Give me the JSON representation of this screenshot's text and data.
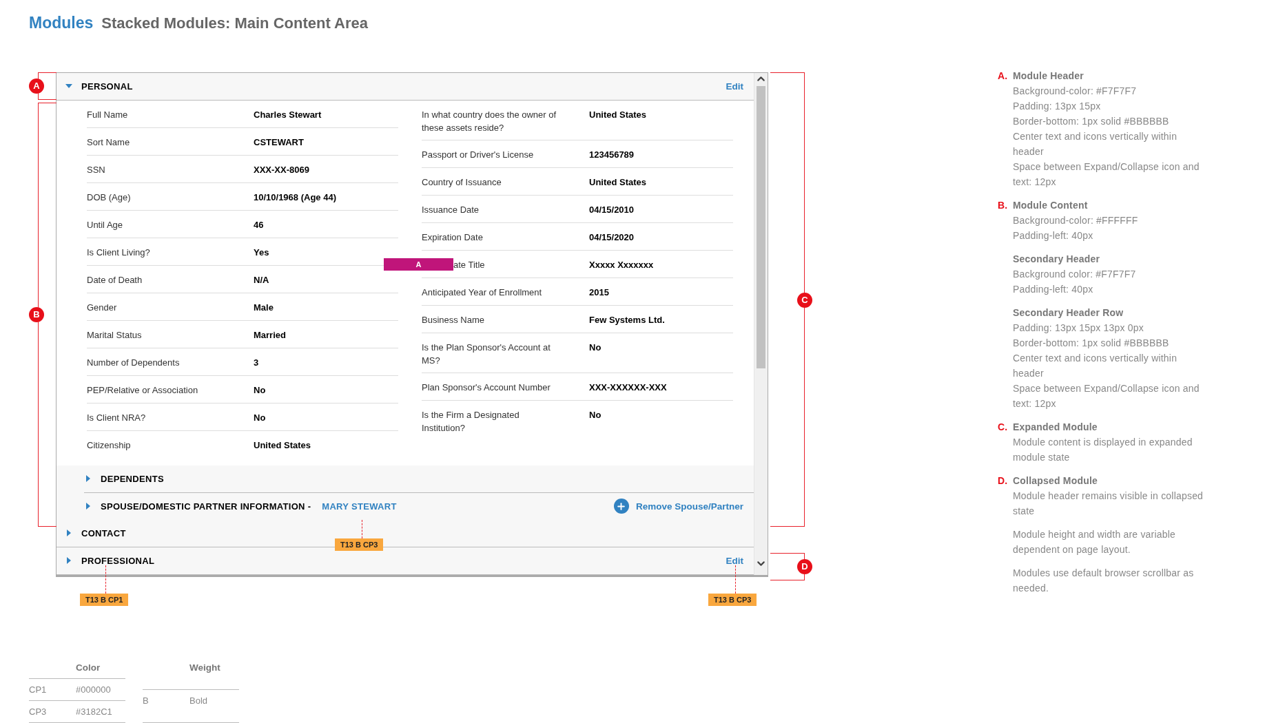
{
  "page": {
    "section": "Modules",
    "title": "Stacked Modules: Main Content Area"
  },
  "modules": [
    {
      "title": "PERSONAL",
      "expanded": true,
      "edit": "Edit",
      "fields_left": [
        {
          "label": "Full Name",
          "value": "Charles Stewart"
        },
        {
          "label": "Sort Name",
          "value": "CSTEWART"
        },
        {
          "label": "SSN",
          "value": "XXX-XX-8069"
        },
        {
          "label": "DOB (Age)",
          "value": "10/10/1968 (Age 44)"
        },
        {
          "label": "Until Age",
          "value": "46"
        },
        {
          "label": "Is Client Living?",
          "value": "Yes"
        },
        {
          "label": "Date of Death",
          "value": "N/A"
        },
        {
          "label": "Gender",
          "value": "Male"
        },
        {
          "label": "Marital Status",
          "value": "Married"
        },
        {
          "label": "Number of Dependents",
          "value": "3"
        },
        {
          "label": "PEP/Relative or Association",
          "value": "No"
        },
        {
          "label": "Is Client NRA?",
          "value": "No"
        },
        {
          "label": "Citizenship",
          "value": "United States"
        }
      ],
      "fields_right": [
        {
          "label": "In what country does the owner of these assets reside?",
          "value": "United States"
        },
        {
          "label": "Passport or Driver's License",
          "value": "123456789"
        },
        {
          "label": "Country of Issuance",
          "value": "United States"
        },
        {
          "label": "Issuance Date",
          "value": "04/15/2010"
        },
        {
          "label": "Expiration Date",
          "value": "04/15/2020"
        },
        {
          "label": "ate Title",
          "value": "Xxxxx Xxxxxxx",
          "marker": "A"
        },
        {
          "label": "Anticipated Year of Enrollment",
          "value": "2015"
        },
        {
          "label": "Business Name",
          "value": "Few Systems Ltd."
        },
        {
          "label": "Is the Plan Sponsor's Account at MS?",
          "value": "No"
        },
        {
          "label": "Plan Sponsor's Account Number",
          "value": "XXX-XXXXXX-XXX"
        },
        {
          "label": "Is the Firm a Designated Institution?",
          "value": "No"
        }
      ],
      "subsections": [
        {
          "title": "DEPENDENTS",
          "expanded": false
        },
        {
          "title": "SPOUSE/DOMESTIC PARTNER INFORMATION -",
          "name": "MARY STEWART",
          "expanded": false,
          "action": "Remove Spouse/Partner"
        }
      ]
    },
    {
      "title": "CONTACT",
      "expanded": false
    },
    {
      "title": "PROFESSIONAL",
      "expanded": false,
      "edit": "Edit"
    }
  ],
  "callouts": [
    "A",
    "B",
    "C",
    "D"
  ],
  "tags": [
    "T13 B CP3",
    "T13 B CP1",
    "T13 B CP3"
  ],
  "notes": [
    {
      "letter": "A.",
      "title": "Module Header",
      "lines": [
        "Background-color: #F7F7F7",
        "Padding: 13px 15px",
        "Border-bottom: 1px solid #BBBBBB",
        "Center text and icons vertically within header",
        "Space between Expand/Collapse icon and text: 12px"
      ]
    },
    {
      "letter": "B.",
      "title": "Module Content",
      "lines": [
        "Background-color: #FFFFFF",
        "Padding-left: 40px"
      ]
    },
    {
      "title": "Secondary Header",
      "lines": [
        "Background color: #F7F7F7",
        "Padding-left: 40px"
      ]
    },
    {
      "title": "Secondary Header Row",
      "lines": [
        "Padding: 13px 15px 13px 0px",
        "Border-bottom: 1px solid #BBBBBB",
        "Center text and icons vertically within header",
        "Space between Expand/Collapse icon and text: 12px"
      ]
    },
    {
      "letter": "C.",
      "title": "Expanded Module",
      "lines": [
        "Module content is displayed in expanded module state"
      ]
    },
    {
      "letter": "D.",
      "title": "Collapsed Module",
      "lines": [
        "Module header remains visible in collapsed state"
      ]
    },
    {
      "lines": [
        "Module height and width are variable dependent on page layout."
      ]
    },
    {
      "lines": [
        "Modules use default browser scrollbar as needed."
      ]
    }
  ],
  "legend": [
    {
      "heading": "Color",
      "rows": [
        [
          "CP1",
          "#000000"
        ],
        [
          "CP3",
          "#3182C1"
        ]
      ]
    },
    {
      "heading": "Weight",
      "rows": [
        [
          "B",
          "Bold"
        ]
      ]
    }
  ]
}
